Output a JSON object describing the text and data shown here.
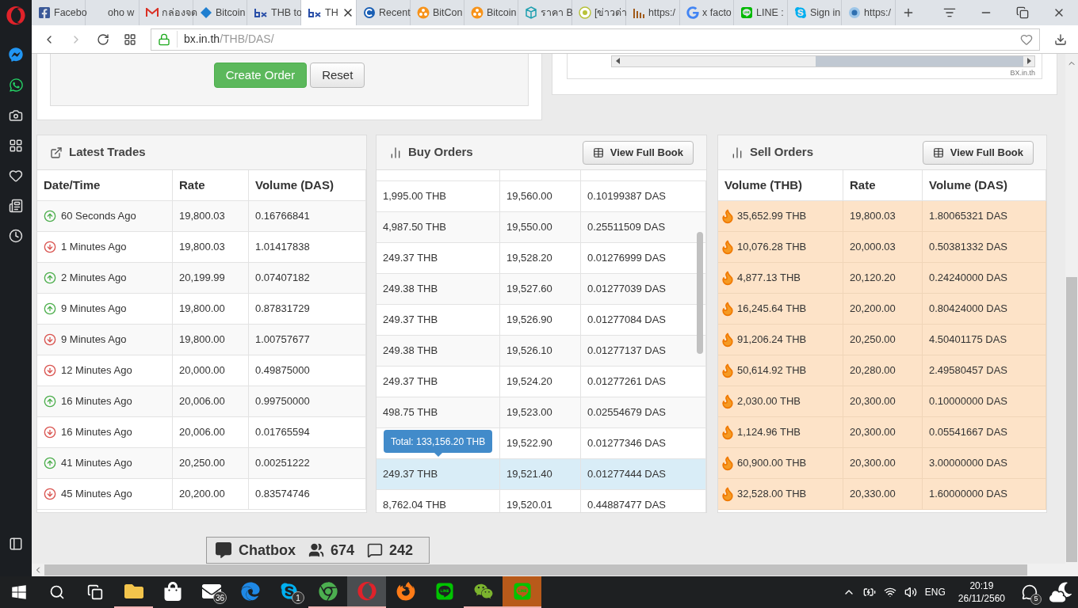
{
  "browser": {
    "tabs": [
      {
        "label": "Facebo",
        "kind": "facebook",
        "selected": false
      },
      {
        "label": "oho w",
        "kind": "blank",
        "selected": false
      },
      {
        "label": "กล่องจด",
        "kind": "gmail",
        "selected": false
      },
      {
        "label": "Bitcoin",
        "kind": "diamond",
        "selected": false
      },
      {
        "label": "THB to",
        "kind": "bx",
        "selected": false
      },
      {
        "label": "TH",
        "kind": "bx",
        "selected": true
      },
      {
        "label": "Recent",
        "kind": "c-circle",
        "selected": false
      },
      {
        "label": "BitCon",
        "kind": "orange-circle",
        "selected": false
      },
      {
        "label": "Bitcoin",
        "kind": "orange-circle",
        "selected": false
      },
      {
        "label": "ราคา B",
        "kind": "cube",
        "selected": false
      },
      {
        "label": "[ข่าวด่า",
        "kind": "yellow-circle",
        "selected": false
      },
      {
        "label": "https:/",
        "kind": "chart",
        "selected": false
      },
      {
        "label": "x facto",
        "kind": "google",
        "selected": false
      },
      {
        "label": "LINE :",
        "kind": "line",
        "selected": false
      },
      {
        "label": "Sign in",
        "kind": "skype",
        "selected": false
      },
      {
        "label": "https:/",
        "kind": "globe",
        "selected": false
      }
    ],
    "address": {
      "host": "bx.in.th",
      "path": "/THB/DAS/"
    }
  },
  "order_form": {
    "buttons": [
      {
        "label": "Create Order",
        "kind": "primary"
      },
      {
        "label": "Reset",
        "kind": "default"
      }
    ]
  },
  "chart_panel": {
    "credit": "BX.in.th"
  },
  "latest_trades": {
    "title": "Latest Trades",
    "columns": [
      "Date/Time",
      "Rate",
      "Volume (DAS)"
    ],
    "rows": [
      {
        "kind": "up",
        "time": "60 Seconds Ago",
        "rate": "19,800.03",
        "volume": "0.16766841"
      },
      {
        "kind": "down",
        "time": "1 Minutes Ago",
        "rate": "19,800.03",
        "volume": "1.01417838"
      },
      {
        "kind": "up",
        "time": "2 Minutes Ago",
        "rate": "20,199.99",
        "volume": "0.07407182"
      },
      {
        "kind": "up",
        "time": "9 Minutes Ago",
        "rate": "19,800.00",
        "volume": "0.87831729"
      },
      {
        "kind": "down",
        "time": "9 Minutes Ago",
        "rate": "19,800.00",
        "volume": "1.00757677"
      },
      {
        "kind": "down",
        "time": "12 Minutes Ago",
        "rate": "20,000.00",
        "volume": "0.49875000"
      },
      {
        "kind": "up",
        "time": "16 Minutes Ago",
        "rate": "20,006.00",
        "volume": "0.99750000"
      },
      {
        "kind": "down",
        "time": "16 Minutes Ago",
        "rate": "20,006.00",
        "volume": "0.01765594"
      },
      {
        "kind": "up",
        "time": "41 Minutes Ago",
        "rate": "20,250.00",
        "volume": "0.00251222"
      },
      {
        "kind": "down",
        "time": "45 Minutes Ago",
        "rate": "20,200.00",
        "volume": "0.83574746"
      }
    ]
  },
  "buy_orders": {
    "title": "Buy Orders",
    "button": "View Full Book",
    "tooltip": "Total: 133,156.20 THB",
    "rows": [
      {
        "volume_thb": "1,995.00 THB",
        "rate": "19,560.00",
        "volume_das": "0.10199387 DAS",
        "selected": false
      },
      {
        "volume_thb": "4,987.50 THB",
        "rate": "19,550.00",
        "volume_das": "0.25511509 DAS",
        "selected": false
      },
      {
        "volume_thb": "249.37 THB",
        "rate": "19,528.20",
        "volume_das": "0.01276999 DAS",
        "selected": false
      },
      {
        "volume_thb": "249.38 THB",
        "rate": "19,527.60",
        "volume_das": "0.01277039 DAS",
        "selected": false
      },
      {
        "volume_thb": "249.37 THB",
        "rate": "19,526.90",
        "volume_das": "0.01277084 DAS",
        "selected": false
      },
      {
        "volume_thb": "249.38 THB",
        "rate": "19,526.10",
        "volume_das": "0.01277137 DAS",
        "selected": false
      },
      {
        "volume_thb": "249.37 THB",
        "rate": "19,524.20",
        "volume_das": "0.01277261 DAS",
        "selected": false
      },
      {
        "volume_thb": "498.75 THB",
        "rate": "19,523.00",
        "volume_das": "0.02554679 DAS",
        "selected": false
      },
      {
        "rate": "19,522.90",
        "volume_das": "0.01277346 DAS",
        "selected": false,
        "tooltip": true
      },
      {
        "volume_thb": "249.37 THB",
        "rate": "19,521.40",
        "volume_das": "0.01277444 DAS",
        "selected": true
      },
      {
        "volume_thb": "8,762.04 THB",
        "rate": "19,520.01",
        "volume_das": "0.44887477 DAS",
        "selected": false
      }
    ]
  },
  "sell_orders": {
    "title": "Sell Orders",
    "button": "View Full Book",
    "columns": [
      "Volume (THB)",
      "Rate",
      "Volume (DAS)"
    ],
    "rows": [
      {
        "volume_thb": "35,652.99 THB",
        "rate": "19,800.03",
        "volume_das": "1.80065321 DAS"
      },
      {
        "volume_thb": "10,076.28 THB",
        "rate": "20,000.03",
        "volume_das": "0.50381332 DAS"
      },
      {
        "volume_thb": "4,877.13 THB",
        "rate": "20,120.20",
        "volume_das": "0.24240000 DAS"
      },
      {
        "volume_thb": "16,245.64 THB",
        "rate": "20,200.00",
        "volume_das": "0.80424000 DAS"
      },
      {
        "volume_thb": "91,206.24 THB",
        "rate": "20,250.00",
        "volume_das": "4.50401175 DAS"
      },
      {
        "volume_thb": "50,614.92 THB",
        "rate": "20,280.00",
        "volume_das": "2.49580457 DAS"
      },
      {
        "volume_thb": "2,030.00 THB",
        "rate": "20,300.00",
        "volume_das": "0.10000000 DAS"
      },
      {
        "volume_thb": "1,124.96 THB",
        "rate": "20,300.00",
        "volume_das": "0.05541667 DAS"
      },
      {
        "volume_thb": "60,900.00 THB",
        "rate": "20,300.00",
        "volume_das": "3.00000000 DAS"
      },
      {
        "volume_thb": "32,528.00 THB",
        "rate": "20,330.00",
        "volume_das": "1.60000000 DAS"
      }
    ]
  },
  "chatbox": {
    "title": "Chatbox",
    "users": "674",
    "messages": "242"
  },
  "taskbar": {
    "apps": [
      {
        "kind": "explorer",
        "open": true
      },
      {
        "kind": "store",
        "open": false
      },
      {
        "kind": "mail",
        "open": false,
        "badge": "36"
      },
      {
        "kind": "edge",
        "open": false
      },
      {
        "kind": "skype",
        "open": false,
        "badge": "1"
      },
      {
        "kind": "chrome",
        "open": true
      },
      {
        "kind": "opera",
        "open": true,
        "active": true
      },
      {
        "kind": "firefox",
        "open": false
      },
      {
        "kind": "line",
        "open": false
      },
      {
        "kind": "wechat",
        "open": true
      },
      {
        "kind": "line",
        "open": true,
        "flashing": true
      }
    ],
    "language": "ENG",
    "time": "20:19",
    "date": "26/11/2560",
    "notifications": "5"
  }
}
